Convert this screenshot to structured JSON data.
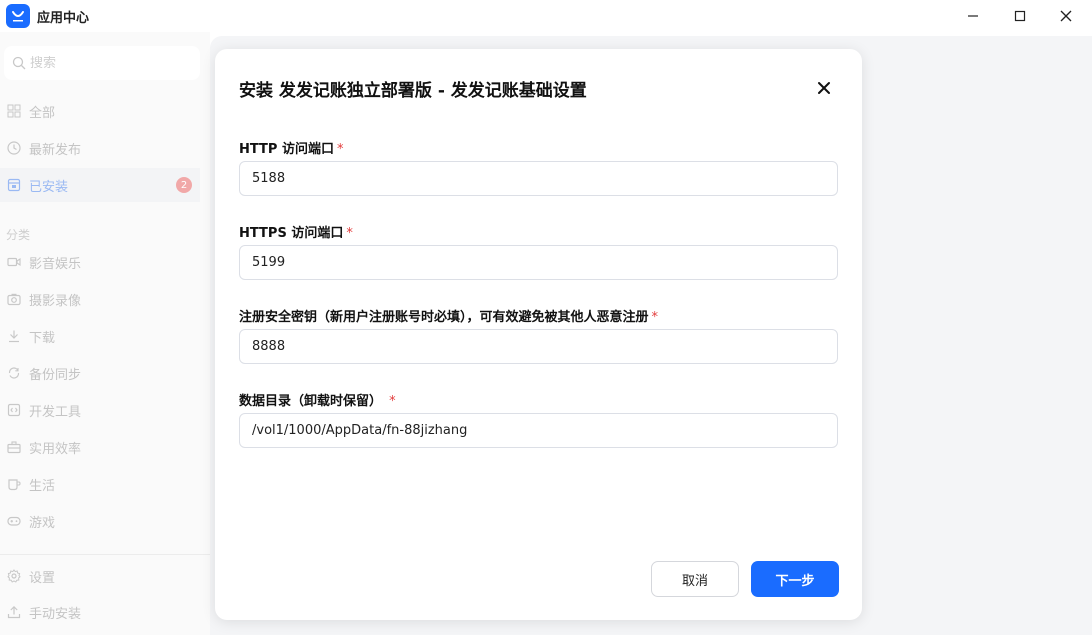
{
  "window": {
    "title": "应用中心",
    "minimize_glyph": "—",
    "maximize_glyph": "☐",
    "close_glyph": "✕"
  },
  "sidebar": {
    "search_placeholder": "搜索",
    "items": [
      {
        "label": "全部",
        "icon": "grid-icon"
      },
      {
        "label": "最新发布",
        "icon": "clock-icon"
      },
      {
        "label": "已安装",
        "icon": "installed-icon",
        "badge": "2"
      }
    ],
    "category_label": "分类",
    "categories": [
      {
        "label": "影音娱乐",
        "icon": "video-icon"
      },
      {
        "label": "摄影录像",
        "icon": "camera-icon"
      },
      {
        "label": "下载",
        "icon": "download-icon"
      },
      {
        "label": "备份同步",
        "icon": "sync-icon"
      },
      {
        "label": "开发工具",
        "icon": "code-icon"
      },
      {
        "label": "实用效率",
        "icon": "toolbox-icon"
      },
      {
        "label": "生活",
        "icon": "cup-icon"
      },
      {
        "label": "游戏",
        "icon": "gamepad-icon"
      }
    ],
    "bottom": [
      {
        "label": "设置",
        "icon": "gear-icon"
      },
      {
        "label": "手动安装",
        "icon": "upload-icon"
      }
    ]
  },
  "dialog": {
    "title": "安装 发发记账独立部署版 - 发发记账基础设置",
    "fields": [
      {
        "label": "HTTP 访问端口",
        "required_mark": "*",
        "value": "5188"
      },
      {
        "label": "HTTPS 访问端口",
        "required_mark": "*",
        "value": "5199"
      },
      {
        "label": "注册安全密钥（新用户注册账号时必填），可有效避免被其他人恶意注册",
        "required_mark": "*",
        "value": "8888"
      },
      {
        "label": "数据目录（卸载时保留）",
        "required_mark": " *",
        "value": "/vol1/1000/AppData/fn-88jizhang"
      }
    ],
    "cancel_label": "取消",
    "next_label": "下一步"
  },
  "colors": {
    "accent": "#1a6cff",
    "required": "#e23b3b",
    "badge": "#f1a8a8"
  }
}
